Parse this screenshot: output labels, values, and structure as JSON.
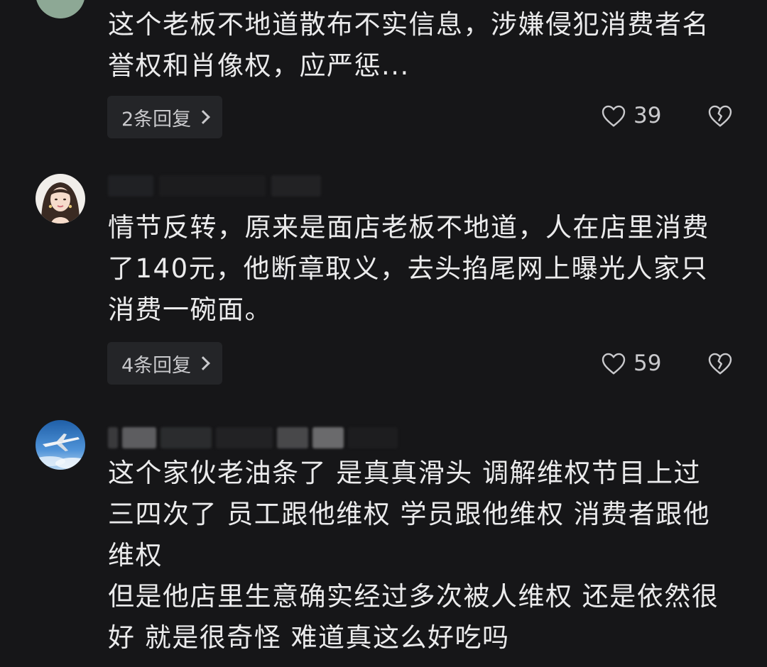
{
  "comments": [
    {
      "text": "这个老板不地道散布不实信息，涉嫌侵犯消费者名\n誉权和肖像权，应严惩...",
      "replies_label": "2条回复",
      "likes": "39"
    },
    {
      "text": "情节反转，原来是面店老板不地道，人在店里消费\n了140元，他断章取义，去头掐尾网上曝光人家只\n消费一碗面。",
      "replies_label": "4条回复",
      "likes": "59"
    },
    {
      "text": "这个家伙老油条了 是真真滑头 调解维权节目上过\n三四次了 员工跟他维权 学员跟他维权 消费者跟他\n维权\n但是他店里生意确实经过多次被人维权 还是依然很\n好 就是很奇怪 难道真这么好吃吗"
    }
  ],
  "icons": {
    "like": "heart-outline-icon",
    "dislike": "broken-heart-icon",
    "reply_arrow": "chevron-right-icon"
  },
  "colors": {
    "background": "#161618",
    "text": "#ebebec",
    "secondary": "#c9c9cc",
    "button_bg": "#242528"
  }
}
